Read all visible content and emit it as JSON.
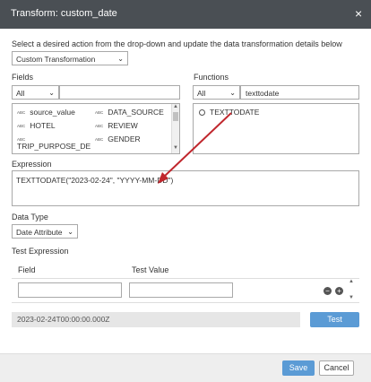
{
  "dialog": {
    "title": "Transform: custom_date",
    "close_glyph": "×"
  },
  "instruction": "Select a desired action from the drop-down and update the data transformation details below",
  "action_select": {
    "value": "Custom Transformation"
  },
  "fields": {
    "label": "Fields",
    "filter_value": "All",
    "search_value": "",
    "items_col1": [
      "source_value",
      "HOTEL",
      "TRIP_PURPOSE_DE"
    ],
    "items_col2": [
      "DATA_SOURCE",
      "REVIEW",
      "GENDER"
    ]
  },
  "functions": {
    "label": "Functions",
    "filter_value": "All",
    "search_value": "texttodate",
    "items": [
      "TEXTTODATE"
    ]
  },
  "expression": {
    "label": "Expression",
    "value": "TEXTTODATE(\"2023-02-24\", \"YYYY-MM-DD\")"
  },
  "data_type": {
    "label": "Data Type",
    "value": "Date Attribute"
  },
  "test_expression": {
    "label": "Test Expression",
    "field_header": "Field",
    "value_header": "Test Value",
    "field_value": "",
    "test_value": "",
    "result": "2023-02-24T00:00:00.000Z",
    "test_button": "Test"
  },
  "footer": {
    "save": "Save",
    "cancel": "Cancel"
  },
  "colors": {
    "titlebar": "#4a4f54",
    "primary": "#5b9bd5",
    "arrow": "#c0272d"
  },
  "icons": {
    "abc": "abc-type-icon",
    "function": "function-icon",
    "remove": "minus-circle-icon",
    "add": "plus-circle-icon"
  }
}
